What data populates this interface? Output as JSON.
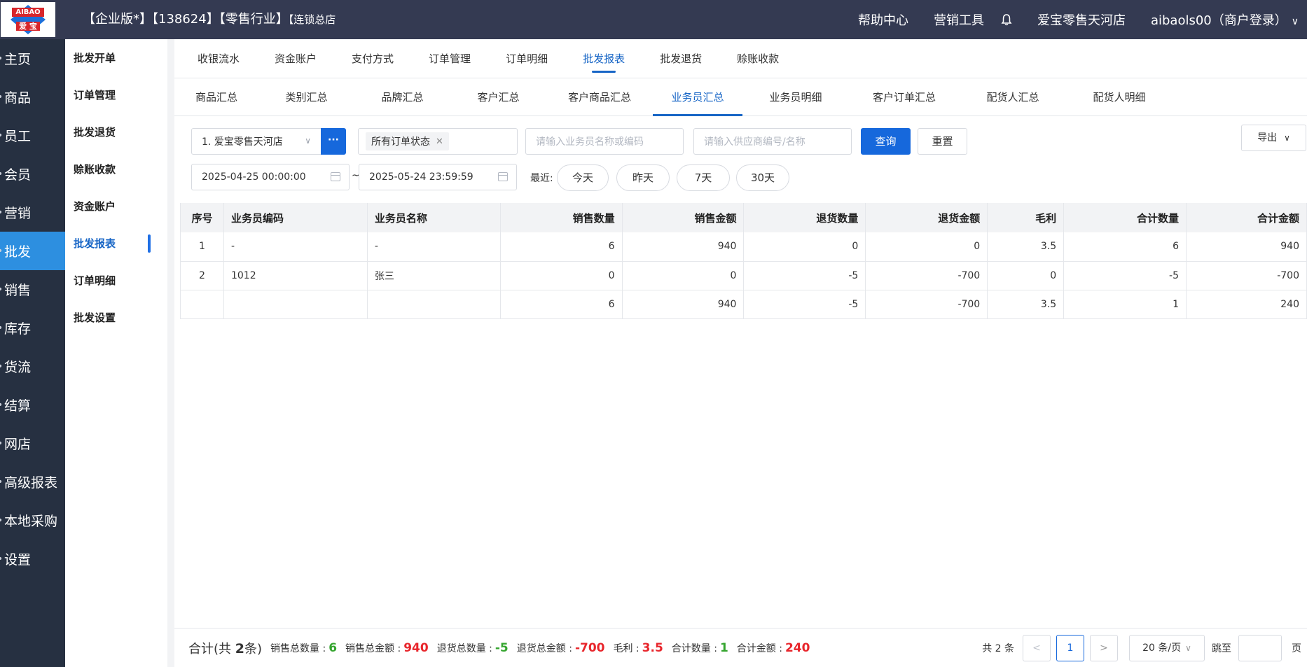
{
  "header": {
    "title_main": "【企业版*】【138624】【零售行业】",
    "title_sub": "【连锁总店",
    "help": "帮助中心",
    "marketing": "营销工具",
    "store": "爱宝零售天河店",
    "user": "aibaols00（商户登录）"
  },
  "logo": {
    "band": "AIBAO",
    "cn": "爱 宝"
  },
  "sidebar": [
    {
      "label": "主页"
    },
    {
      "label": "商品"
    },
    {
      "label": "员工"
    },
    {
      "label": "会员"
    },
    {
      "label": "营销"
    },
    {
      "label": "批发"
    },
    {
      "label": "销售"
    },
    {
      "label": "库存"
    },
    {
      "label": "货流"
    },
    {
      "label": "结算"
    },
    {
      "label": "网店"
    },
    {
      "label": "高级报表"
    },
    {
      "label": "本地采购"
    },
    {
      "label": "设置"
    }
  ],
  "subnav": [
    {
      "label": "批发开单"
    },
    {
      "label": "订单管理"
    },
    {
      "label": "批发退货"
    },
    {
      "label": "赊账收款"
    },
    {
      "label": "资金账户"
    },
    {
      "label": "批发报表"
    },
    {
      "label": "订单明细"
    },
    {
      "label": "批发设置"
    }
  ],
  "tabs1": [
    {
      "label": "收银流水"
    },
    {
      "label": "资金账户"
    },
    {
      "label": "支付方式"
    },
    {
      "label": "订单管理"
    },
    {
      "label": "订单明细"
    },
    {
      "label": "批发报表"
    },
    {
      "label": "批发退货"
    },
    {
      "label": "赊账收款"
    }
  ],
  "tabs2": [
    {
      "label": "商品汇总"
    },
    {
      "label": "类别汇总"
    },
    {
      "label": "品牌汇总"
    },
    {
      "label": "客户汇总"
    },
    {
      "label": "客户商品汇总"
    },
    {
      "label": "业务员汇总"
    },
    {
      "label": "业务员明细"
    },
    {
      "label": "客户订单汇总"
    },
    {
      "label": "配货人汇总"
    },
    {
      "label": "配货人明细"
    }
  ],
  "filters": {
    "store": "1. 爱宝零售天河店",
    "more": "···",
    "status_tag": "所有订单状态",
    "salesman_placeholder": "请输入业务员名称或编码",
    "supplier_placeholder": "请输入供应商编号/名称",
    "query": "查询",
    "reset": "重置",
    "export": "导出",
    "date_start": "2025-04-25 00:00:00",
    "date_sep": "~",
    "date_end": "2025-05-24 23:59:59",
    "recent_label": "最近:",
    "quick": [
      "今天",
      "昨天",
      "7天",
      "30天"
    ]
  },
  "table": {
    "columns": [
      "序号",
      "业务员编码",
      "业务员名称",
      "销售数量",
      "销售金额",
      "退货数量",
      "退货金额",
      "毛利",
      "合计数量",
      "合计金额"
    ],
    "rows": [
      [
        "1",
        "-",
        "-",
        "6",
        "940",
        "0",
        "0",
        "3.5",
        "6",
        "940"
      ],
      [
        "2",
        "1012",
        "张三",
        "0",
        "0",
        "-5",
        "-700",
        "0",
        "-5",
        "-700"
      ],
      [
        "",
        "",
        "",
        "6",
        "940",
        "-5",
        "-700",
        "3.5",
        "1",
        "240"
      ]
    ]
  },
  "footer": {
    "total_prefix": "合计(共 ",
    "total_count": "2",
    "total_suffix": "条)",
    "stats": [
      {
        "label": "销售总数量 :",
        "value": "6",
        "color": "green"
      },
      {
        "label": "销售总金额 :",
        "value": "940",
        "color": "red"
      },
      {
        "label": "退货总数量 :",
        "value": "-5",
        "color": "green"
      },
      {
        "label": "退货总金额 :",
        "value": "-700",
        "color": "red"
      },
      {
        "label": "毛利 :",
        "value": "3.5",
        "color": "red"
      },
      {
        "label": "合计数量 :",
        "value": "1",
        "color": "green"
      },
      {
        "label": "合计金额 :",
        "value": "240",
        "color": "red"
      }
    ],
    "pager_total": "共 2 条",
    "page_current": "1",
    "page_size": "20 条/页",
    "goto_label": "跳至",
    "page_unit": "页"
  }
}
